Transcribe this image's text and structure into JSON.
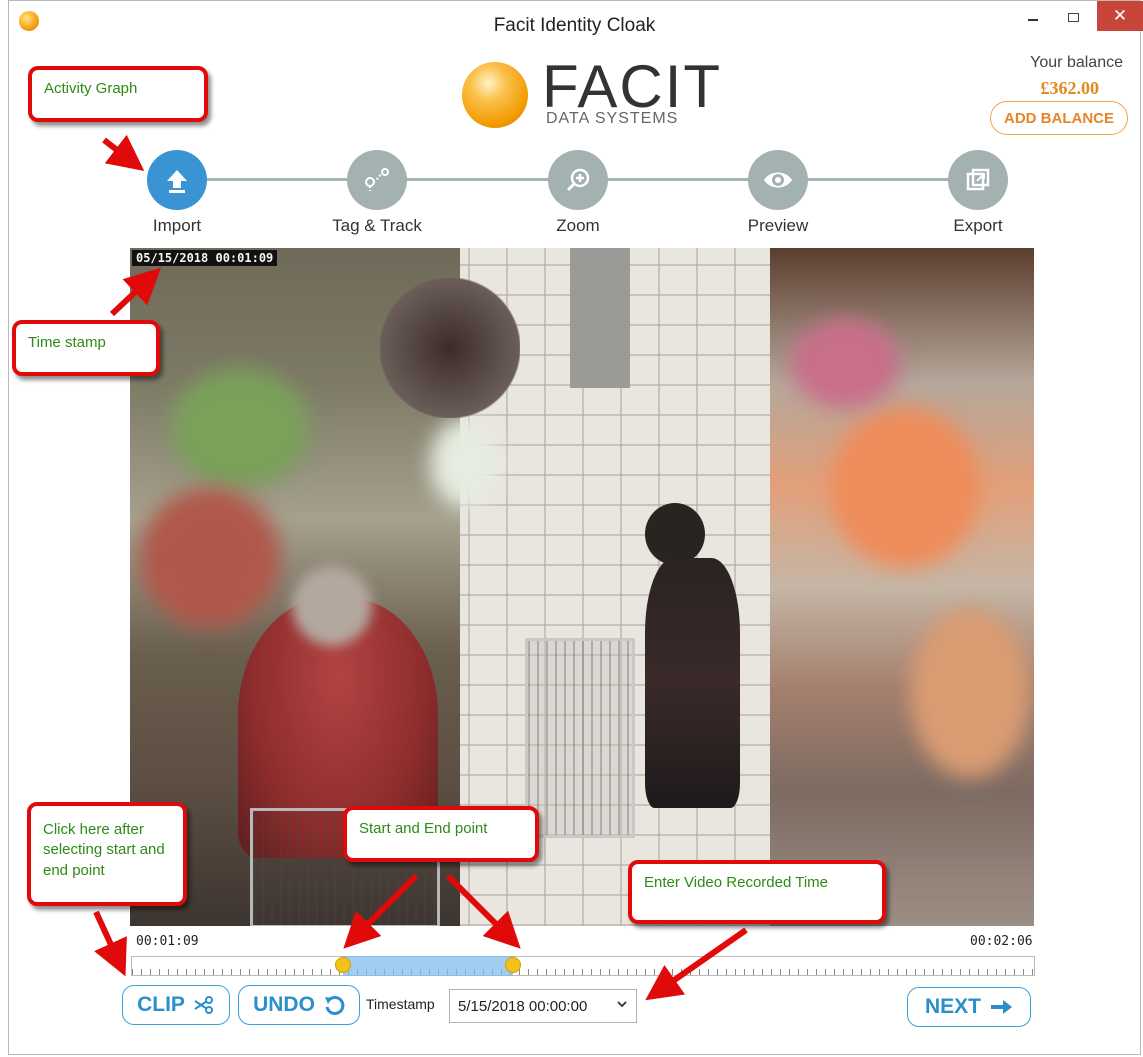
{
  "window": {
    "title": "Facit Identity Cloak",
    "close_glyph": "✕"
  },
  "header": {
    "logo_main": "FACIT",
    "logo_sub": "DATA SYSTEMS",
    "balance_label": "Your balance",
    "balance_value": "£362.00",
    "add_balance_label": "ADD BALANCE"
  },
  "steps": [
    {
      "label": "Import",
      "icon": "upload-icon",
      "active": true
    },
    {
      "label": "Tag & Track",
      "icon": "route-icon",
      "active": false
    },
    {
      "label": "Zoom",
      "icon": "zoom-in-icon",
      "active": false
    },
    {
      "label": "Preview",
      "icon": "eye-icon",
      "active": false
    },
    {
      "label": "Export",
      "icon": "export-icon",
      "active": false
    }
  ],
  "video": {
    "timestamp_overlay": "05/15/2018 00:01:09"
  },
  "timeline": {
    "start_time": "00:01:09",
    "end_time": "00:02:06",
    "selection_start_fraction": 0.235,
    "selection_end_fraction": 0.423
  },
  "controls": {
    "clip_label": "CLIP",
    "undo_label": "UNDO",
    "timestamp_label": "Timestamp",
    "timestamp_value": "5/15/2018 00:00:00",
    "next_label": "NEXT"
  },
  "annotations": {
    "activity_graph": "Activity Graph",
    "time_stamp": "Time stamp",
    "click_here": "Click here after selecting start and end point",
    "start_end": "Start and End point",
    "enter_time": "Enter Video Recorded Time"
  },
  "colors": {
    "accent_blue": "#3a93d2",
    "step_inactive": "#a4b1b1",
    "balance_orange": "#e08a1c",
    "callout_border": "#e10a0a",
    "callout_text": "#2f8a17",
    "handle_yellow": "#f3c21b",
    "range_blue": "#82beeb"
  }
}
